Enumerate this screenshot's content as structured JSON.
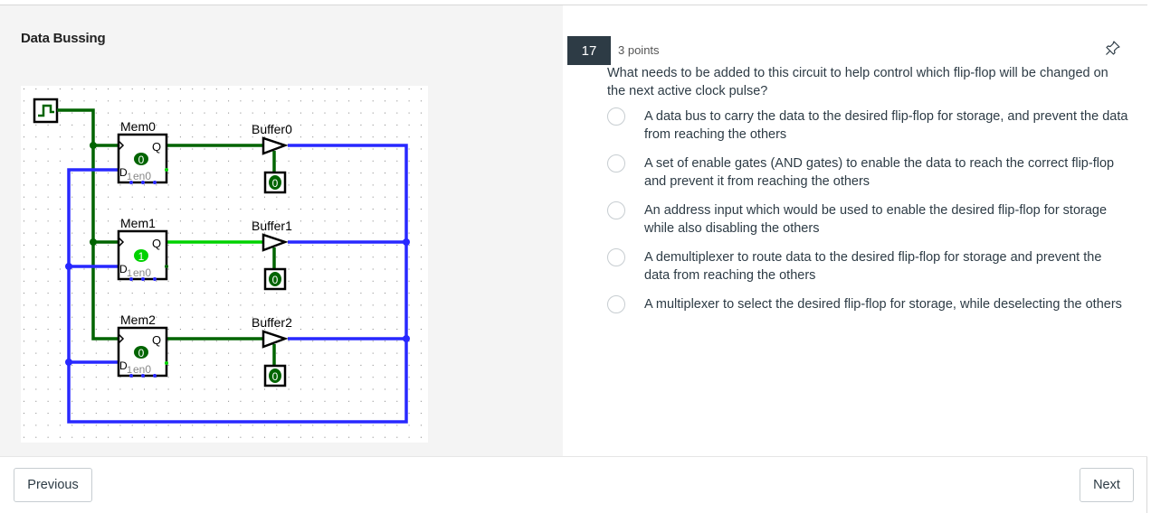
{
  "left_panel": {
    "title": "Data Bussing"
  },
  "circuit": {
    "clock_icon": "clock-square-wave-icon",
    "flip_flops": [
      {
        "label": "Mem0",
        "value": "0",
        "active": false,
        "pins": {
          "clock": "",
          "q": "Q",
          "d": "D",
          "sub1": "1",
          "en": "en0"
        }
      },
      {
        "label": "Mem1",
        "value": "1",
        "active": true,
        "pins": {
          "clock": "",
          "q": "Q",
          "d": "D",
          "sub1": "1",
          "en": "en0"
        }
      },
      {
        "label": "Mem2",
        "value": "0",
        "active": false,
        "pins": {
          "clock": "",
          "q": "Q",
          "d": "D",
          "sub1": "1",
          "en": "en0"
        }
      }
    ],
    "buffers": [
      {
        "label": "Buffer0",
        "enable_value": "0"
      },
      {
        "label": "Buffer1",
        "enable_value": "0"
      },
      {
        "label": "Buffer2",
        "enable_value": "0"
      }
    ],
    "colors": {
      "wire_low": "#006400",
      "wire_high": "#00d200",
      "bus": "#2828ff",
      "outline": "#000000",
      "grid_dot": "#808080"
    }
  },
  "question": {
    "number": "17",
    "points": "3 points",
    "pin_icon": "pin-icon",
    "text": "What needs to be added to this circuit to help control which flip-flop will be changed on the next active clock pulse?",
    "options": [
      {
        "label": "A data bus to carry the data to the desired flip-flop for storage, and prevent the data from reaching the others",
        "selected": false
      },
      {
        "label": "A set of enable gates (AND gates) to enable the data to reach the correct flip-flop and prevent it from reaching the others",
        "selected": false
      },
      {
        "label": "An address input which would be used to enable the desired flip-flop for storage while also disabling the others",
        "selected": false
      },
      {
        "label": "A demultiplexer to route data to the desired flip-flop for storage and prevent the data from reaching the others",
        "selected": false
      },
      {
        "label": "A multiplexer to select the desired flip-flop for storage, while deselecting the others",
        "selected": false
      }
    ]
  },
  "navigation": {
    "previous_label": "Previous",
    "next_label": "Next"
  }
}
